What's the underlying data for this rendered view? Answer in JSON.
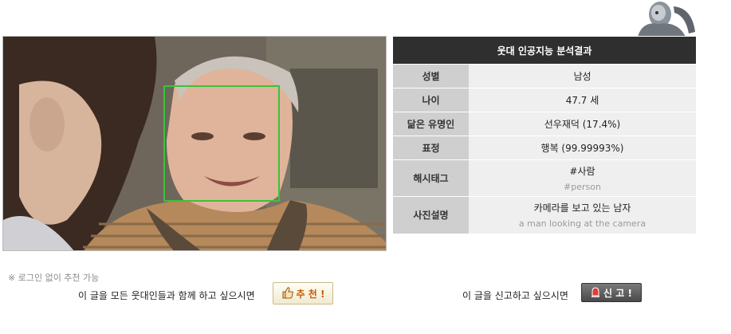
{
  "result": {
    "header": "웃대 인공지능 분석결과",
    "rows": [
      {
        "key": "성별",
        "value": "남성"
      },
      {
        "key": "나이",
        "value": "47.7 세"
      },
      {
        "key": "닮은 유명인",
        "value": "선우재덕 (17.4%)"
      },
      {
        "key": "표정",
        "value": "행복 (99.99993%)"
      },
      {
        "key": "해시태그",
        "value": "#사람",
        "sub": "#person"
      },
      {
        "key": "사진설명",
        "value": "카메라를 보고 있는 남자",
        "sub": "a man looking at the camera"
      }
    ]
  },
  "footer": {
    "note": "※ 로그인 없이 추천 가능",
    "share_text": "이 글을 모든 웃대인들과 함께 하고 싶으시면",
    "recommend_label": "추 천 !",
    "report_text": "이 글을 신고하고 싶으시면",
    "report_label": "신 고 !"
  },
  "colors": {
    "face_box": "#3bc23b",
    "header_bg": "#2f2f2f",
    "recommend_text": "#c85a00"
  },
  "icons": [
    "robot-icon",
    "thumbs-up-icon",
    "siren-icon"
  ]
}
